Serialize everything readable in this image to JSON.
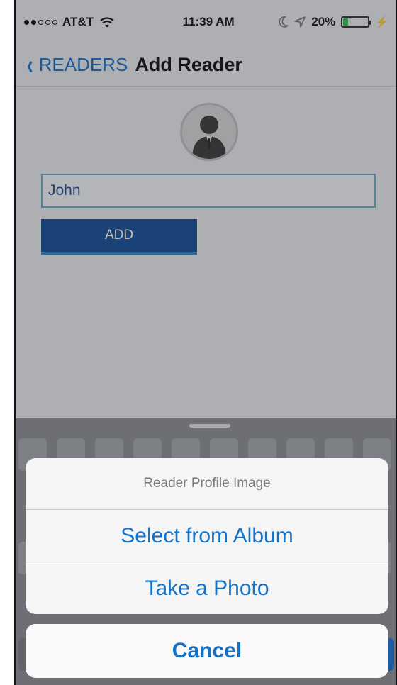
{
  "status_bar": {
    "carrier": "AT&T",
    "time": "11:39 AM",
    "battery": "20%",
    "battery_fraction": 0.2
  },
  "nav": {
    "back_label": "READERS",
    "title": "Add Reader"
  },
  "form": {
    "name_value": "John",
    "add_label": "ADD"
  },
  "action_sheet": {
    "title": "Reader Profile Image",
    "options": [
      "Select from Album",
      "Take a Photo"
    ],
    "cancel_label": "Cancel"
  },
  "colors": {
    "accent": "#1572c9",
    "button": "#164e96",
    "field_border": "#6aa9c8"
  }
}
